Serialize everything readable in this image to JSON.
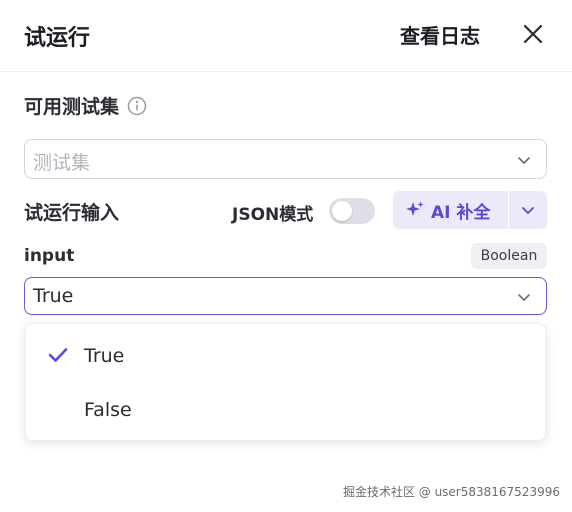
{
  "header": {
    "title": "试运行",
    "log_label": "查看日志"
  },
  "testset": {
    "label": "可用测试集",
    "placeholder": "测试集"
  },
  "run_input": {
    "label": "试运行输入",
    "json_mode_label": "JSON模式",
    "json_mode_on": false,
    "ai_button_label": "AI 补全"
  },
  "field": {
    "name": "input",
    "type_badge": "Boolean",
    "selected_value": "True",
    "options": [
      {
        "label": "True",
        "selected": true
      },
      {
        "label": "False",
        "selected": false
      }
    ]
  },
  "watermark": "掘金技术社区 @ user5838167523996",
  "colors": {
    "accent": "#5b48d6",
    "ai_button_bg": "#ece9fb",
    "focus_border": "#6a5ad8"
  },
  "icons": {
    "close": "close-icon",
    "info": "info-icon",
    "chevron": "chevron-down-icon",
    "sparkle": "sparkle-icon",
    "check": "check-icon"
  }
}
